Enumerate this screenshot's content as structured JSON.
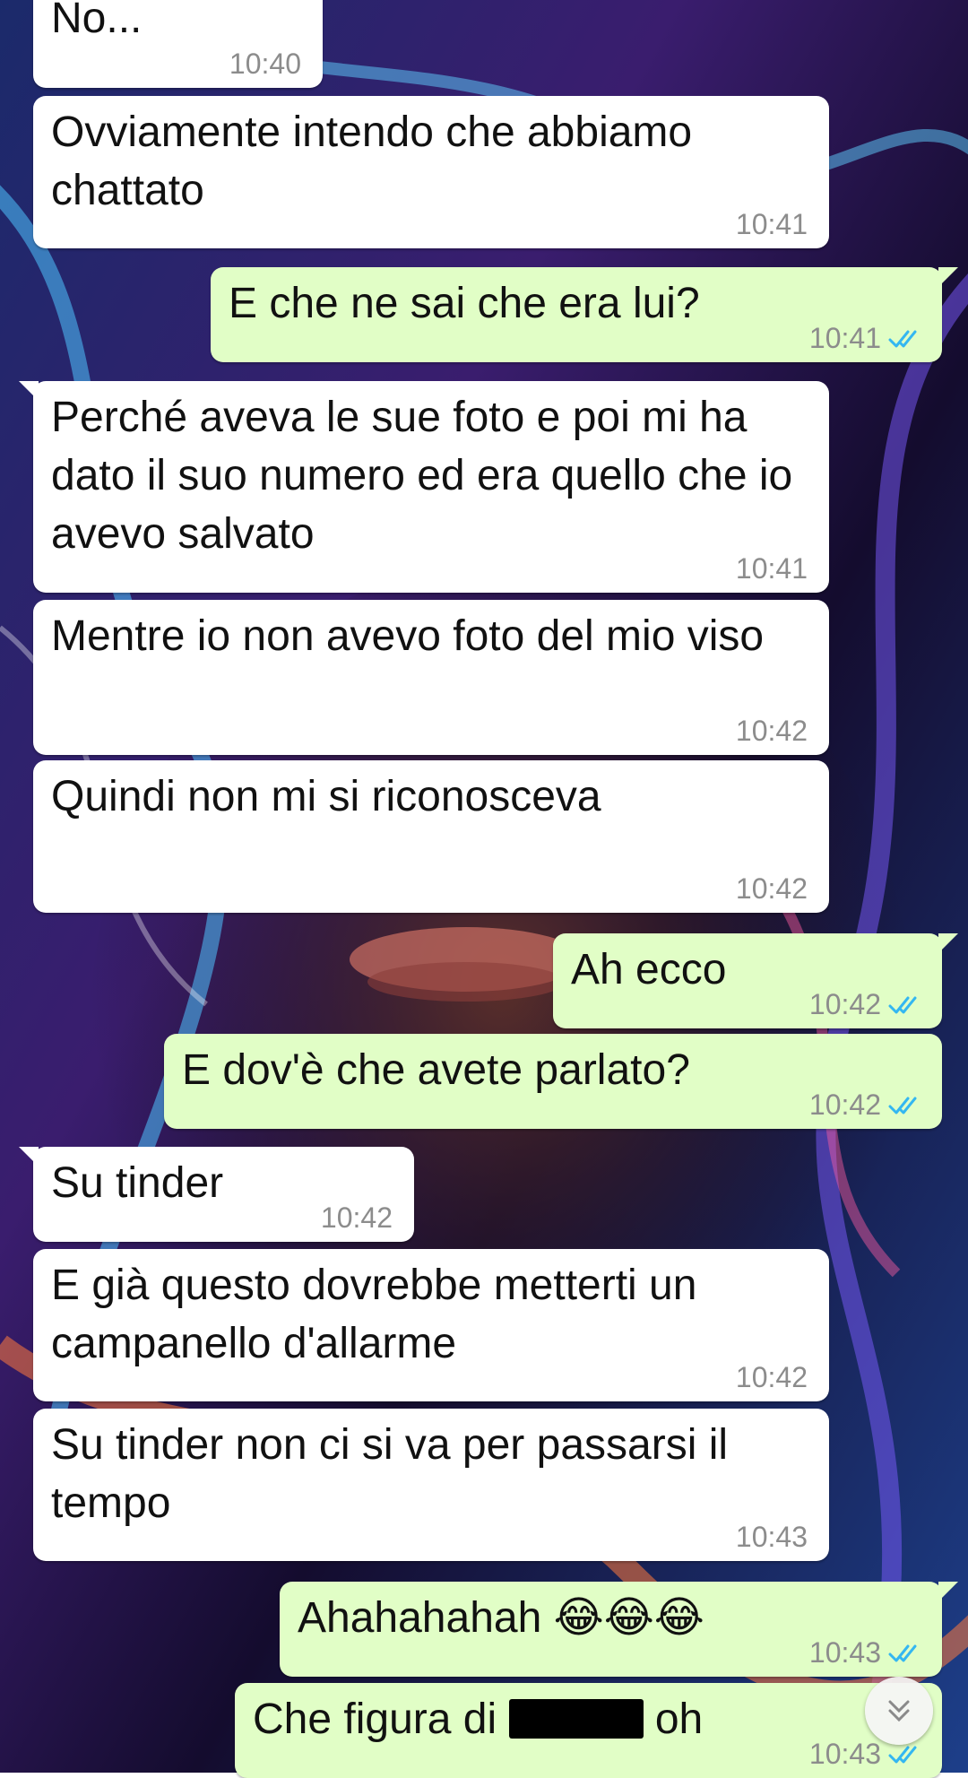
{
  "messages": [
    {
      "dir": "in",
      "text": "No...",
      "time": "10:40"
    },
    {
      "dir": "in",
      "text": "Ovviamente intendo che abbiamo chattato",
      "time": "10:41"
    },
    {
      "dir": "out",
      "text": "E che ne sai che era lui?",
      "time": "10:41",
      "status": "read"
    },
    {
      "dir": "in",
      "text": "Perché aveva le sue foto e poi mi ha dato il suo numero ed era quello che io avevo salvato",
      "time": "10:41"
    },
    {
      "dir": "in",
      "text": "Mentre io non avevo foto del mio viso",
      "time": "10:42"
    },
    {
      "dir": "in",
      "text": "Quindi non mi si riconosceva",
      "time": "10:42"
    },
    {
      "dir": "out",
      "text": "Ah ecco",
      "time": "10:42",
      "status": "read"
    },
    {
      "dir": "out",
      "text": "E dov'è che avete parlato?",
      "time": "10:42",
      "status": "read"
    },
    {
      "dir": "in",
      "text": "Su tinder",
      "time": "10:42"
    },
    {
      "dir": "in",
      "text": "E già questo dovrebbe metterti un campanello d'allarme",
      "time": "10:42"
    },
    {
      "dir": "in",
      "text": "Su tinder non ci si va per passarsi il tempo",
      "time": "10:43"
    },
    {
      "dir": "out",
      "text": "Ahahahahah 😂😂😂",
      "time": "10:43",
      "status": "read"
    },
    {
      "dir": "out",
      "text_before": "Che figura di",
      "text_after": "oh",
      "redacted": true,
      "time": "10:43",
      "status": "read"
    }
  ],
  "colors": {
    "incoming_bubble": "#ffffff",
    "outgoing_bubble": "#e1fec6",
    "timestamp": "#8c8c8c",
    "read_ticks": "#34b7f1"
  },
  "icons": {
    "read_receipt": "double-check-icon",
    "scroll_down": "double-chevron-down-icon"
  }
}
